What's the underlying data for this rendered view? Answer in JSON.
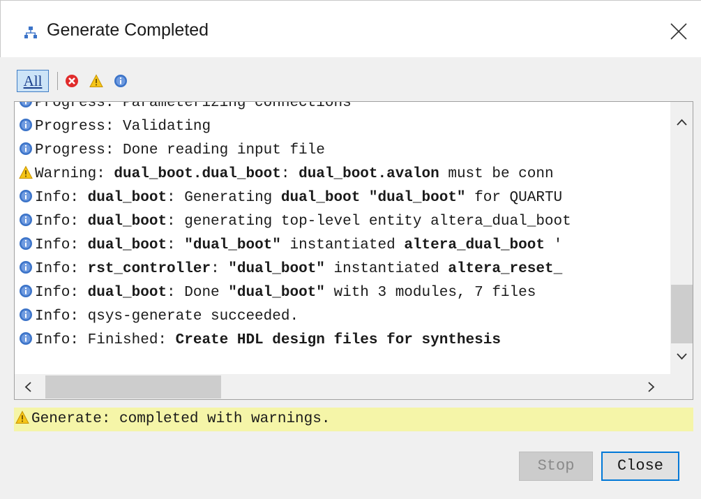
{
  "window": {
    "title": "Generate Completed",
    "title_icon": "hierarchy-icon",
    "close_icon": "close-icon"
  },
  "toolbar": {
    "all_label": "All",
    "filters": [
      "error-filter-icon",
      "warning-filter-icon",
      "info-filter-icon"
    ]
  },
  "log": {
    "lines": [
      {
        "type": "info",
        "segments": [
          {
            "text": "Progress: Parameterizing connections",
            "bold": false
          }
        ]
      },
      {
        "type": "info",
        "segments": [
          {
            "text": "Progress: Validating",
            "bold": false
          }
        ]
      },
      {
        "type": "info",
        "segments": [
          {
            "text": "Progress: Done reading input file",
            "bold": false
          }
        ]
      },
      {
        "type": "warning",
        "segments": [
          {
            "text": "Warning: ",
            "bold": false
          },
          {
            "text": "dual_boot.dual_boot",
            "bold": true
          },
          {
            "text": ": ",
            "bold": false
          },
          {
            "text": "dual_boot.avalon",
            "bold": true
          },
          {
            "text": " must be conn",
            "bold": false
          }
        ]
      },
      {
        "type": "info",
        "segments": [
          {
            "text": "Info: ",
            "bold": false
          },
          {
            "text": "dual_boot",
            "bold": true
          },
          {
            "text": ": Generating ",
            "bold": false
          },
          {
            "text": "dual_boot \"dual_boot\"",
            "bold": true
          },
          {
            "text": " for QUARTU",
            "bold": false
          }
        ]
      },
      {
        "type": "info",
        "segments": [
          {
            "text": "Info: ",
            "bold": false
          },
          {
            "text": "dual_boot",
            "bold": true
          },
          {
            "text": ": generating top-level entity altera_dual_boot",
            "bold": false
          }
        ]
      },
      {
        "type": "info",
        "segments": [
          {
            "text": "Info: ",
            "bold": false
          },
          {
            "text": "dual_boot",
            "bold": true
          },
          {
            "text": ": ",
            "bold": false
          },
          {
            "text": "\"dual_boot\"",
            "bold": true
          },
          {
            "text": " instantiated ",
            "bold": false
          },
          {
            "text": "altera_dual_boot",
            "bold": true
          },
          {
            "text": " '",
            "bold": false
          }
        ]
      },
      {
        "type": "info",
        "segments": [
          {
            "text": "Info: ",
            "bold": false
          },
          {
            "text": "rst_controller",
            "bold": true
          },
          {
            "text": ": ",
            "bold": false
          },
          {
            "text": "\"dual_boot\"",
            "bold": true
          },
          {
            "text": " instantiated ",
            "bold": false
          },
          {
            "text": "altera_reset_",
            "bold": true
          }
        ]
      },
      {
        "type": "info",
        "segments": [
          {
            "text": "Info: ",
            "bold": false
          },
          {
            "text": "dual_boot",
            "bold": true
          },
          {
            "text": ": Done ",
            "bold": false
          },
          {
            "text": "\"dual_boot\"",
            "bold": true
          },
          {
            "text": " with 3 modules, 7 files",
            "bold": false
          }
        ]
      },
      {
        "type": "info",
        "segments": [
          {
            "text": "Info: qsys-generate succeeded.",
            "bold": false
          }
        ]
      },
      {
        "type": "info",
        "segments": [
          {
            "text": "Info: Finished: ",
            "bold": false
          },
          {
            "text": "Create HDL design files for synthesis",
            "bold": true
          }
        ]
      }
    ]
  },
  "status": {
    "icon": "warning-icon",
    "text": "Generate: completed with warnings."
  },
  "buttons": {
    "stop_label": "Stop",
    "close_label": "Close"
  },
  "colors": {
    "status_background": "#f5f5a8",
    "close_button_border": "#0078d7",
    "info_icon": "#3b73c8",
    "error_icon": "#e02b2b",
    "warning_icon": "#f0b400"
  }
}
